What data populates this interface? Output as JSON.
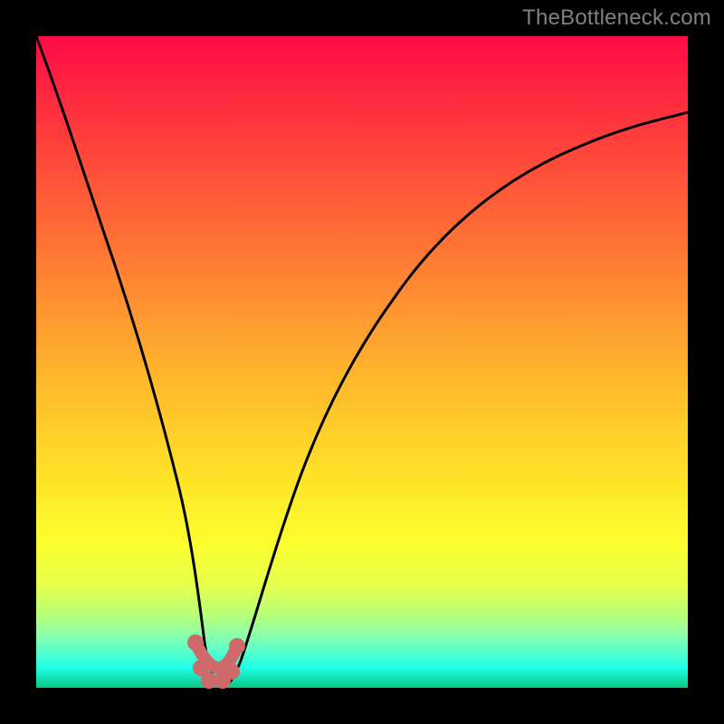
{
  "watermark": {
    "text": "TheBottleneck.com"
  },
  "colors": {
    "frame_bg": "#000000",
    "watermark_text": "#808080",
    "curve_stroke": "#000000",
    "dots_fill": "#cf6a6a",
    "gradient_stops": [
      "#ff0b46",
      "#ff3f3c",
      "#ff7a34",
      "#ffb62c",
      "#ffe328",
      "#fbff2e",
      "#e6ff4a",
      "#b6ff7a",
      "#8affad",
      "#4cffd0",
      "#1dffe8",
      "#13e3b6",
      "#09c97f"
    ]
  },
  "chart_data": {
    "type": "line",
    "title": "",
    "xlabel": "",
    "ylabel": "",
    "xlim": [
      0,
      100
    ],
    "ylim": [
      0,
      100
    ],
    "grid": false,
    "legend": false,
    "series": [
      {
        "name": "curve",
        "x": [
          0,
          4,
          8,
          12,
          16,
          20,
          24,
          26,
          28,
          30,
          32,
          36,
          40,
          46,
          54,
          64,
          76,
          90,
          100
        ],
        "y": [
          100,
          89,
          77,
          65,
          52,
          38,
          19,
          7,
          0,
          0,
          3,
          13,
          25,
          39,
          52,
          63,
          72,
          78,
          81
        ],
        "color": "#000000"
      }
    ],
    "annotations": {
      "dots": {
        "color": "#cf6a6a",
        "points": [
          {
            "x": 24.3,
            "y": 6.9
          },
          {
            "x": 25.1,
            "y": 3.0
          },
          {
            "x": 26.4,
            "y": 1.0
          },
          {
            "x": 28.6,
            "y": 1.0
          },
          {
            "x": 30.0,
            "y": 2.5
          },
          {
            "x": 30.8,
            "y": 6.4
          }
        ]
      }
    }
  }
}
